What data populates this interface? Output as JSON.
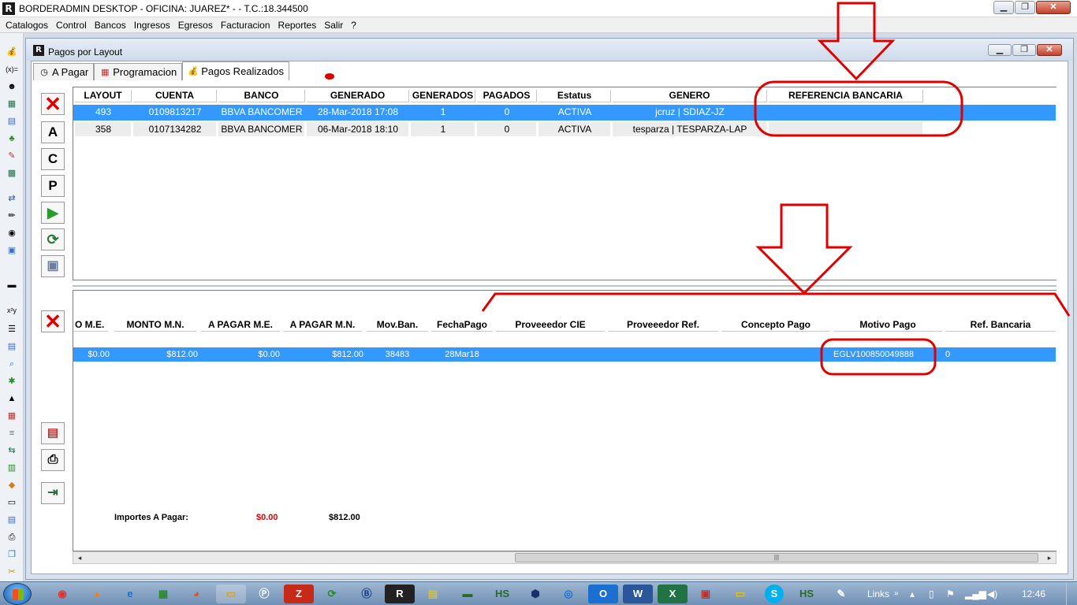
{
  "app": {
    "title": "BORDERADMIN DESKTOP - OFICINA: JUAREZ* -  - T.C.:18.344500",
    "logo": "R"
  },
  "menu": [
    "Catalogos",
    "Control",
    "Bancos",
    "Ingresos",
    "Egresos",
    "Facturacion",
    "Reportes",
    "Salir",
    "?"
  ],
  "child_window": {
    "title": "Pagos por Layout",
    "logo": "R"
  },
  "tabs": [
    {
      "label": "A Pagar",
      "icon": "clock-icon"
    },
    {
      "label": "Programacion",
      "icon": "calendar-icon"
    },
    {
      "label": "Pagos Realizados",
      "icon": "money-bag-icon"
    }
  ],
  "buttons": {
    "delete_top": "✕",
    "a": "A",
    "c": "C",
    "p": "P",
    "delete_bottom": "✕"
  },
  "top_table": {
    "columns": [
      "LAYOUT",
      "CUENTA",
      "BANCO",
      "GENERADO",
      "GENERADOS",
      "PAGADOS",
      "Estatus",
      "GENERO",
      "REFERENCIA BANCARIA"
    ],
    "rows": [
      [
        "493",
        "0109813217",
        "BBVA BANCOMER",
        "28-Mar-2018 17:08",
        "1",
        "0",
        "ACTIVA",
        "jcruz | SDIAZ-JZ",
        ""
      ],
      [
        "358",
        "0107134282",
        "BBVA BANCOMER",
        "06-Mar-2018 18:10",
        "1",
        "0",
        "ACTIVA",
        "tesparza | TESPARZA-LAP",
        ""
      ]
    ],
    "selected_row": 0
  },
  "bottom_table": {
    "columns": [
      "O M.E.",
      "MONTO M.N.",
      "A PAGAR M.E.",
      "A PAGAR M.N.",
      "Mov.Ban.",
      "FechaPago",
      "Proveeedor CIE",
      "Proveeedor Ref.",
      "Concepto Pago",
      "Motivo Pago",
      "Ref. Bancaria"
    ],
    "rows": [
      [
        "$0.00",
        "$812.00",
        "$0.00",
        "$812.00",
        "38483",
        "28Mar18",
        "",
        "",
        "",
        "EGLV100850049888",
        "0"
      ]
    ]
  },
  "totals": {
    "label": "Importes A Pagar:",
    "me": "$0.00",
    "mn": "$812.00"
  },
  "taskbar": {
    "links": "Links",
    "clock": "12:46"
  },
  "colors": {
    "selection": "#3399ff",
    "annotation": "#e00000"
  }
}
